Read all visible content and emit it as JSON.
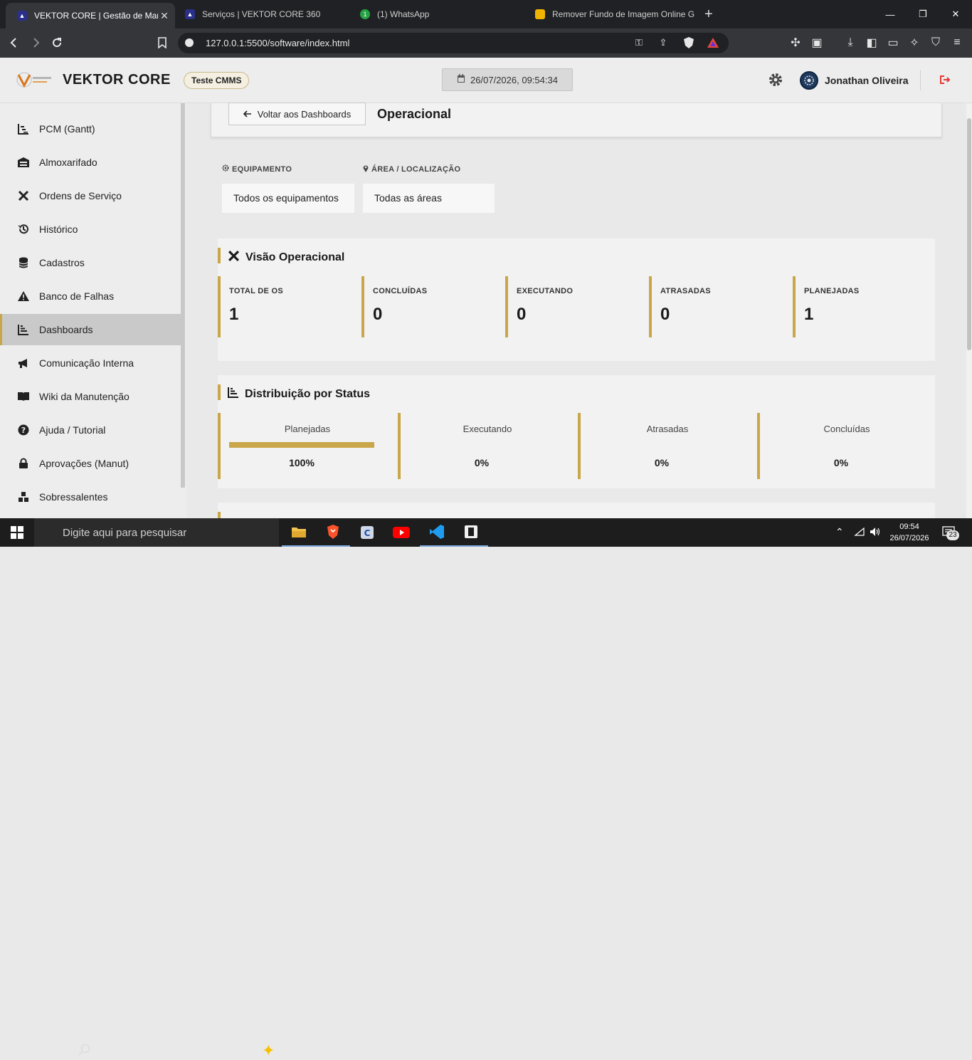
{
  "browser": {
    "tabs": [
      {
        "title": "VEKTOR CORE | Gestão de Manute",
        "active": true
      },
      {
        "title": "Serviços | VEKTOR CORE 360",
        "active": false
      },
      {
        "title": "(1) WhatsApp",
        "active": false,
        "badge": "1"
      },
      {
        "title": "Remover Fundo de Imagem Online G",
        "active": false
      }
    ],
    "url": "127.0.0.1:5500/software/index.html"
  },
  "header": {
    "brand": "VEKTOR CORE",
    "env_badge": "Teste CMMS",
    "datetime": "26/07/2026, 09:54:34",
    "user_name": "Jonathan Oliveira"
  },
  "sidebar": {
    "items": [
      {
        "label": "PCM (Gantt)",
        "icon": "gantt-chart-icon",
        "active": false
      },
      {
        "label": "Almoxarifado",
        "icon": "warehouse-icon",
        "active": false
      },
      {
        "label": "Ordens de Serviço",
        "icon": "tools-icon",
        "active": false
      },
      {
        "label": "Histórico",
        "icon": "history-icon",
        "active": false
      },
      {
        "label": "Cadastros",
        "icon": "database-icon",
        "active": false
      },
      {
        "label": "Banco de Falhas",
        "icon": "warning-icon",
        "active": false
      },
      {
        "label": "Dashboards",
        "icon": "chart-icon",
        "active": true
      },
      {
        "label": "Comunicação Interna",
        "icon": "megaphone-icon",
        "active": false
      },
      {
        "label": "Wiki da Manutenção",
        "icon": "book-icon",
        "active": false
      },
      {
        "label": "Ajuda / Tutorial",
        "icon": "question-icon",
        "active": false
      },
      {
        "label": "Aprovações (Manut)",
        "icon": "lock-icon",
        "active": false
      },
      {
        "label": "Sobressalentes",
        "icon": "boxes-icon",
        "active": false
      }
    ]
  },
  "main": {
    "back_label": "Voltar aos Dashboards",
    "page_title": "Operacional",
    "filters": {
      "equipment_label": "EQUIPAMENTO",
      "equipment_value": "Todos os equipamentos",
      "area_label": "ÁREA / LOCALIZAÇÃO",
      "area_value": "Todas as áreas"
    },
    "overview": {
      "title": "Visão Operacional",
      "kpis": [
        {
          "label": "TOTAL DE OS",
          "value": "1"
        },
        {
          "label": "CONCLUÍDAS",
          "value": "0"
        },
        {
          "label": "EXECUTANDO",
          "value": "0"
        },
        {
          "label": "ATRASADAS",
          "value": "0"
        },
        {
          "label": "PLANEJADAS",
          "value": "1"
        }
      ]
    },
    "status": {
      "title": "Distribuição por Status",
      "items": [
        {
          "label": "Planejadas",
          "percent": 100,
          "percent_text": "100%"
        },
        {
          "label": "Executando",
          "percent": 0,
          "percent_text": "0%"
        },
        {
          "label": "Atrasadas",
          "percent": 0,
          "percent_text": "0%"
        },
        {
          "label": "Concluídas",
          "percent": 0,
          "percent_text": "0%"
        }
      ]
    }
  },
  "taskbar": {
    "search_placeholder": "Digite aqui para pesquisar",
    "time": "09:54",
    "date": "26/07/2026",
    "notifications": "23"
  },
  "colors": {
    "accent": "#c9a64a",
    "danger": "#e53935"
  }
}
